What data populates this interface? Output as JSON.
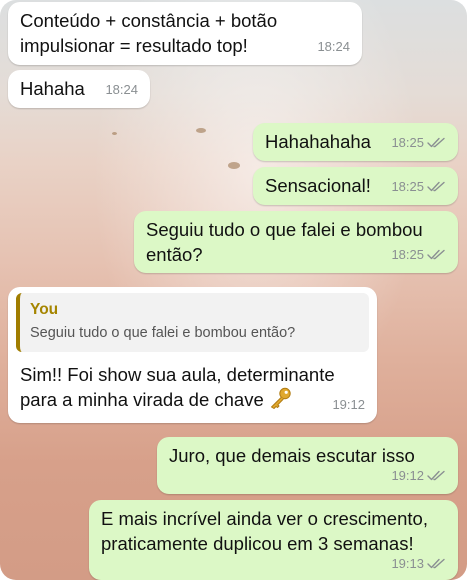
{
  "messages": [
    {
      "id": "m1",
      "text": "Conteúdo + constância + botão\nimpulsionar = resultado top!",
      "time": "18:24"
    },
    {
      "id": "m2",
      "text": "Hahaha",
      "time": "18:24"
    },
    {
      "id": "m3",
      "text": "Hahahahaha",
      "time": "18:25"
    },
    {
      "id": "m4",
      "text": "Sensacional!",
      "time": "18:25"
    },
    {
      "id": "m5",
      "text": "Seguiu tudo o que falei e bombou\nentão?",
      "time": "18:25"
    },
    {
      "id": "m6",
      "quote_author": "You",
      "quote_text": "Seguiu tudo o que falei e bombou então?",
      "text": "Sim!! Foi show sua aula, determinante\npara a minha virada de chave",
      "emoji": "key-icon",
      "time": "19:12"
    },
    {
      "id": "m7",
      "text": "Juro, que demais escutar isso",
      "time": "19:12"
    },
    {
      "id": "m8",
      "text": "E mais incrível ainda ver o crescimento,\npraticamente duplicou em 3 semanas!",
      "time": "19:13"
    }
  ],
  "colors": {
    "incoming_bubble": "#ffffff",
    "outgoing_bubble": "#dcf8c6",
    "quote_author": "#a58500",
    "timestamp": "#8a8f92",
    "read_ticks": "#8a8f92"
  }
}
